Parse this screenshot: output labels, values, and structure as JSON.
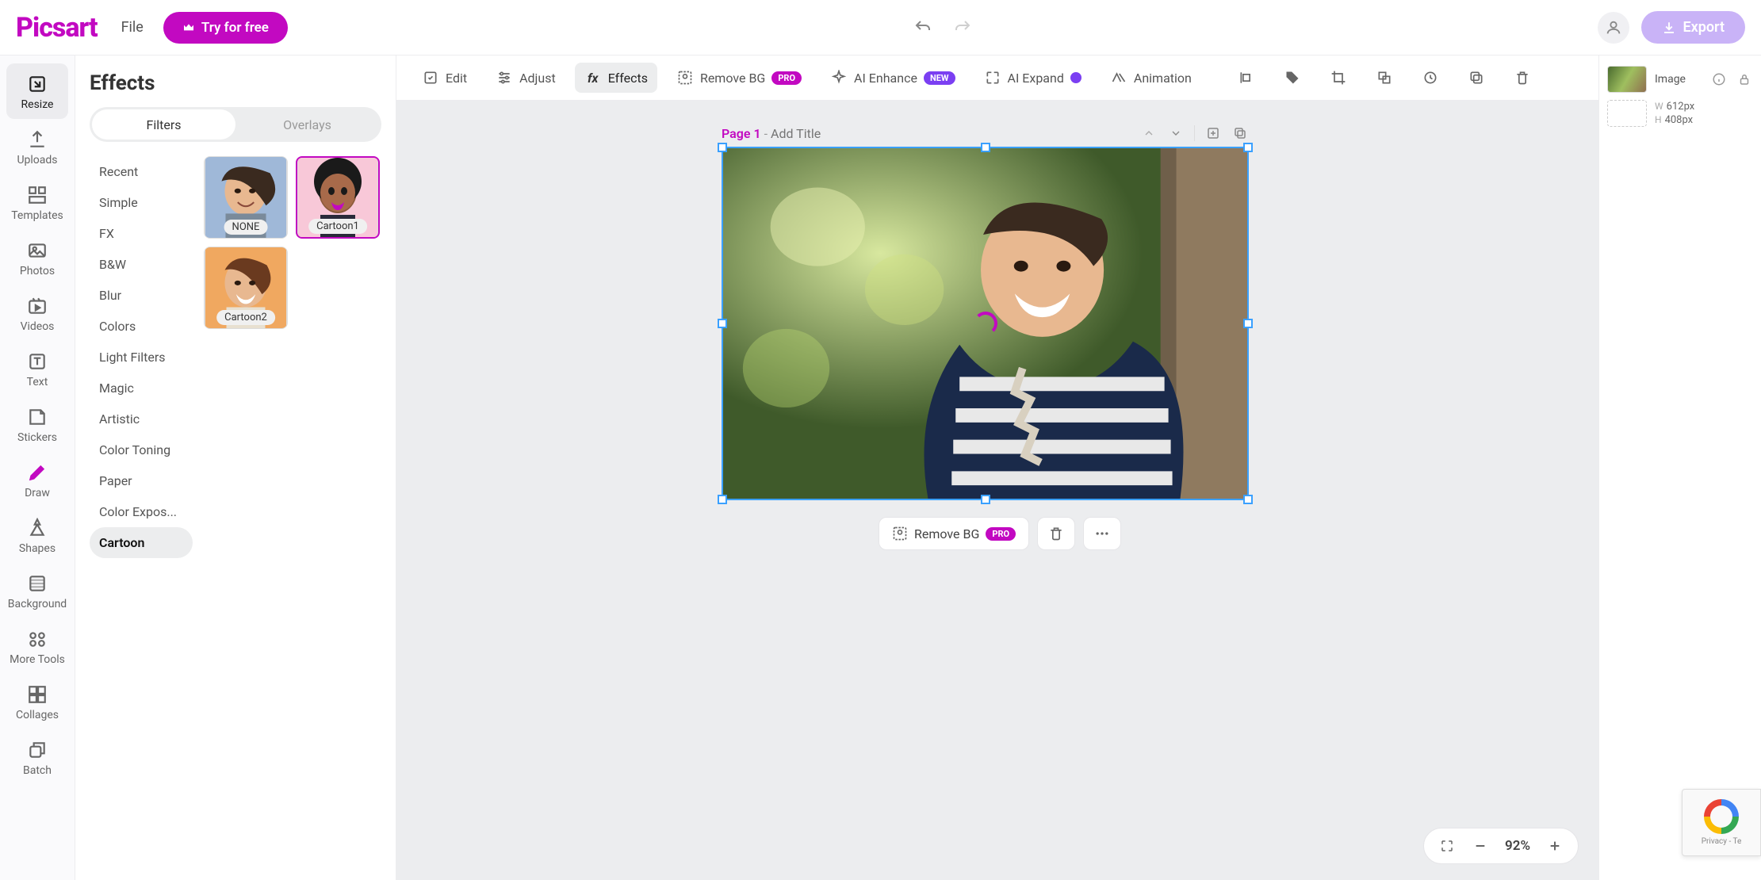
{
  "header": {
    "logo": "Picsart",
    "file_label": "File",
    "try_label": "Try for free",
    "export_label": "Export"
  },
  "leftRail": {
    "items": [
      {
        "label": "Resize",
        "icon": "resize-icon",
        "active": true
      },
      {
        "label": "Uploads",
        "icon": "upload-icon"
      },
      {
        "label": "Templates",
        "icon": "templates-icon"
      },
      {
        "label": "Photos",
        "icon": "photos-icon"
      },
      {
        "label": "Videos",
        "icon": "videos-icon"
      },
      {
        "label": "Text",
        "icon": "text-icon"
      },
      {
        "label": "Stickers",
        "icon": "stickers-icon"
      },
      {
        "label": "Draw",
        "icon": "draw-icon"
      },
      {
        "label": "Shapes",
        "icon": "shapes-icon"
      },
      {
        "label": "Background",
        "icon": "background-icon"
      },
      {
        "label": "More Tools",
        "icon": "moretools-icon"
      },
      {
        "label": "Collages",
        "icon": "collages-icon"
      },
      {
        "label": "Batch",
        "icon": "batch-icon"
      }
    ]
  },
  "panel": {
    "title": "Effects",
    "tabs": [
      {
        "label": "Filters",
        "active": true
      },
      {
        "label": "Overlays"
      }
    ],
    "categories": [
      "Recent",
      "Simple",
      "FX",
      "B&W",
      "Blur",
      "Colors",
      "Light Filters",
      "Magic",
      "Artistic",
      "Color Toning",
      "Paper",
      "Color Expos...",
      "Cartoon"
    ],
    "activeCategory": "Cartoon",
    "thumbs": [
      {
        "label": "NONE",
        "selected": false
      },
      {
        "label": "Cartoon1",
        "selected": true
      },
      {
        "label": "Cartoon2",
        "selected": false
      }
    ]
  },
  "toolbar": {
    "edit": "Edit",
    "adjust": "Adjust",
    "effects": "Effects",
    "removebg": "Remove BG",
    "removebg_badge": "PRO",
    "aienhance": "AI Enhance",
    "aienhance_badge": "NEW",
    "aiexpand": "AI Expand",
    "animation": "Animation"
  },
  "canvas": {
    "page_label": "Page 1",
    "title_placeholder": "Add Title"
  },
  "floatbar": {
    "removebg": "Remove BG",
    "removebg_badge": "PRO"
  },
  "zoom": {
    "value": "92%"
  },
  "rightPanel": {
    "layer_name": "Image",
    "w_label": "W",
    "w_value": "612px",
    "h_label": "H",
    "h_value": "408px"
  },
  "recaptcha": {
    "line1": "Privacy",
    "line2": "Terms"
  }
}
